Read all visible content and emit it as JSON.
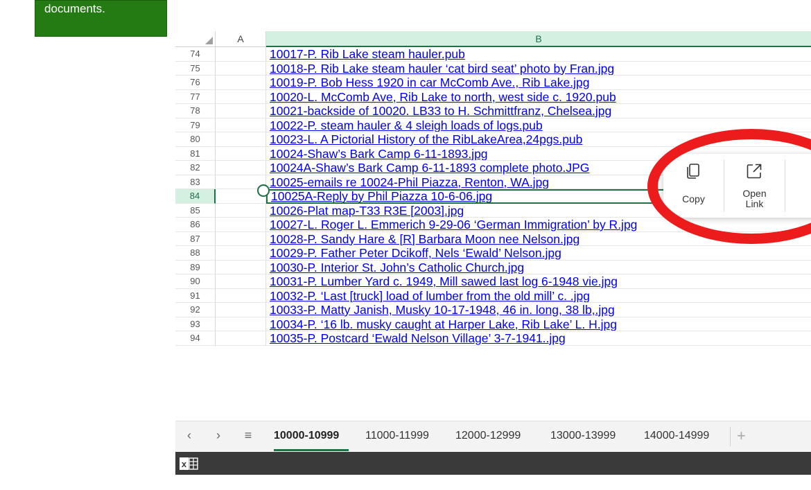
{
  "note_card": {
    "text": "documents."
  },
  "column_headers": {
    "a": "A",
    "b": "B"
  },
  "rows": [
    {
      "num": "74",
      "b": "10017-P. Rib Lake steam hauler.pub"
    },
    {
      "num": "75",
      "b": "10018-P. Rib Lake steam hauler ‘cat bird seat’ photo by Fran.jpg"
    },
    {
      "num": "76",
      "b": "10019-P. Bob Hess 1920 in car McComb Ave., Rib Lake.jpg"
    },
    {
      "num": "77",
      "b": "10020-L. McComb Ave, Rib Lake to north, west side c. 1920.pub"
    },
    {
      "num": "78",
      "b": "10021-backside of 10020. LB33 to H. Schmittfranz, Chelsea.jpg"
    },
    {
      "num": "79",
      "b": "10022-P. steam hauler & 4 sleigh loads of logs.pub"
    },
    {
      "num": "80",
      "b": "10023-L. A Pictorial  History  of  the  RibLakeArea,24pgs.pub"
    },
    {
      "num": "81",
      "b": "10024-Shaw’s Bark Camp 6-11-1893.jpg"
    },
    {
      "num": "82",
      "b": "10024A-Shaw’s Bark Camp 6-11-1893 complete photo.JPG"
    },
    {
      "num": "83",
      "b": "10025-emails re 10024-Phil Piazza, Renton, WA.jpg"
    },
    {
      "num": "84",
      "b": "10025A-Reply by Phil Piazza 10-6-06.jpg",
      "active": true
    },
    {
      "num": "85",
      "b": "10026-Plat map-T33 R3E [2003].jpg"
    },
    {
      "num": "86",
      "b": "10027-L. Roger L. Emmerich 9-29-06 ‘German Immigration’ by R.jpg"
    },
    {
      "num": "87",
      "b": "10028-P. Sandy Hare & [R] Barbara Moon nee Nelson.jpg"
    },
    {
      "num": "88",
      "b": "10029-P. Father Peter Dcikoff, Nels ‘Ewald’ Nelson.jpg"
    },
    {
      "num": "89",
      "b": "10030-P. Interior St. John’s Catholic Church.jpg"
    },
    {
      "num": "90",
      "b": "10031-P. Lumber Yard c. 1949, Mill sawed last log 6-1948 vie.jpg"
    },
    {
      "num": "91",
      "b": "10032-P. ‘Last [truck] load of lumber from the old mill’ c. .jpg"
    },
    {
      "num": "92",
      "b": "10033-P. Matty Janish, Musky 10-17-1948, 46 in. long, 38 lb,.jpg"
    },
    {
      "num": "93",
      "b": "10034-P. ‘16 lb. musky caught at Harper Lake, Rib Lake’ L. H.jpg"
    },
    {
      "num": "94",
      "b": "10035-P. Postcard ‘Ewald Nelson Village’ 3-7-1941..jpg"
    }
  ],
  "popup": {
    "copy_label": "Copy",
    "open_link_label_1": "Open",
    "open_link_label_2": "Link"
  },
  "tabs": [
    {
      "label": "10000-10999",
      "active": true
    },
    {
      "label": "11000-11999"
    },
    {
      "label": "12000-12999"
    },
    {
      "label": "13000-13999"
    },
    {
      "label": "14000-14999"
    }
  ],
  "tab_nav": {
    "prev": "‹",
    "next": "›",
    "menu": "≡",
    "add": "+"
  },
  "colors": {
    "accent_green": "#1e7145",
    "card_green": "#247a13",
    "link_blue": "#0000ee",
    "annotation_red": "#ec1c1c"
  },
  "icons": [
    "copy-icon",
    "open-link-icon",
    "excel-app-icon"
  ]
}
